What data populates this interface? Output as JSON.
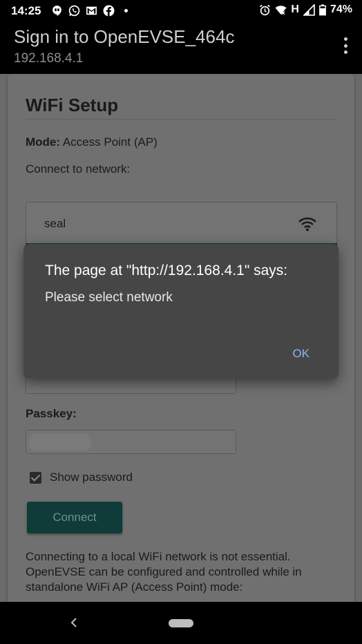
{
  "status_bar": {
    "time": "14:25",
    "battery": "74%",
    "network_type": "H",
    "left_icons": [
      "hangouts-icon",
      "whatsapp-icon",
      "gmail-icon",
      "facebook-icon",
      "notification-dot-icon"
    ],
    "right_icons": [
      "alarm-icon",
      "wifi-off-icon",
      "signal-icon",
      "battery-icon"
    ]
  },
  "app_bar": {
    "title": "Sign in to OpenEVSE_464c",
    "url": "192.168.4.1",
    "menu_icon": "overflow-menu-icon"
  },
  "page": {
    "title": "WiFi Setup",
    "mode_label": "Mode:",
    "mode_value": "Access Point (AP)",
    "connect_label": "Connect to network:",
    "networks": [
      {
        "name": "seal",
        "icon": "wifi-icon"
      }
    ],
    "passkey_label": "Passkey:",
    "show_password_label": "Show password",
    "show_password_checked": true,
    "connect_button": "Connect",
    "info_text": "Connecting to a local WiFi network is not essential. OpenEVSE can be configured and controlled while in standalone WiFi AP (Access Point) mode:"
  },
  "dialog": {
    "title": "The page at \"http://192.168.4.1\" says:",
    "message": "Please select network",
    "ok_label": "OK"
  },
  "colors": {
    "accent": "#0f3c38",
    "dialog_bg": "#464646",
    "dialog_button": "#8ab4f8"
  }
}
